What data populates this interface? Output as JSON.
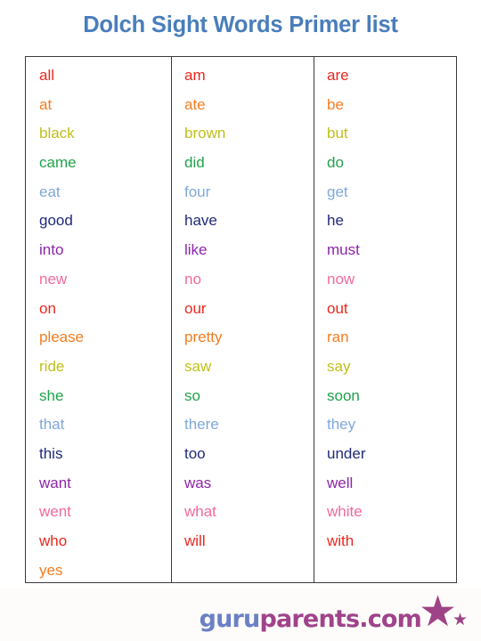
{
  "page": {
    "title": "Dolch Sight Words Primer list",
    "background_color": "#ffffff",
    "title_color": "#4a7ebb",
    "border_color": "#3b3b3b"
  },
  "palette": {
    "red": "#e8281e",
    "orange": "#f57c20",
    "olive": "#bfbf1a",
    "green": "#21a24a",
    "light_blue": "#7fa8dc",
    "navy": "#1f2a7a",
    "purple": "#8e24aa",
    "pink": "#f2699f"
  },
  "table": {
    "columns": [
      {
        "name": "column-1",
        "words": [
          {
            "text": "all",
            "color": "#e8281e"
          },
          {
            "text": "at",
            "color": "#f57c20"
          },
          {
            "text": "black",
            "color": "#bfbf1a"
          },
          {
            "text": "came",
            "color": "#21a24a"
          },
          {
            "text": "eat",
            "color": "#7fa8dc"
          },
          {
            "text": "good",
            "color": "#1f2a7a"
          },
          {
            "text": "into",
            "color": "#8e24aa"
          },
          {
            "text": "new",
            "color": "#f2699f"
          },
          {
            "text": "on",
            "color": "#e8281e"
          },
          {
            "text": "please",
            "color": "#f57c20"
          },
          {
            "text": "ride",
            "color": "#bfbf1a"
          },
          {
            "text": "she",
            "color": "#21a24a"
          },
          {
            "text": "that",
            "color": "#7fa8dc"
          },
          {
            "text": "this",
            "color": "#1f2a7a"
          },
          {
            "text": "want",
            "color": "#8e24aa"
          },
          {
            "text": "went",
            "color": "#f2699f"
          },
          {
            "text": "who",
            "color": "#e8281e"
          },
          {
            "text": "yes",
            "color": "#f57c20"
          }
        ]
      },
      {
        "name": "column-2",
        "words": [
          {
            "text": "am",
            "color": "#e8281e"
          },
          {
            "text": "ate",
            "color": "#f57c20"
          },
          {
            "text": "brown",
            "color": "#bfbf1a"
          },
          {
            "text": "did",
            "color": "#21a24a"
          },
          {
            "text": "four",
            "color": "#7fa8dc"
          },
          {
            "text": "have",
            "color": "#1f2a7a"
          },
          {
            "text": "like",
            "color": "#8e24aa"
          },
          {
            "text": "no",
            "color": "#f2699f"
          },
          {
            "text": "our",
            "color": "#e8281e"
          },
          {
            "text": "pretty",
            "color": "#f57c20"
          },
          {
            "text": "saw",
            "color": "#bfbf1a"
          },
          {
            "text": "so",
            "color": "#21a24a"
          },
          {
            "text": "there",
            "color": "#7fa8dc"
          },
          {
            "text": "too",
            "color": "#1f2a7a"
          },
          {
            "text": "was",
            "color": "#8e24aa"
          },
          {
            "text": "what",
            "color": "#f2699f"
          },
          {
            "text": "will",
            "color": "#e8281e"
          }
        ]
      },
      {
        "name": "column-3",
        "words": [
          {
            "text": "are",
            "color": "#e8281e"
          },
          {
            "text": "be",
            "color": "#f57c20"
          },
          {
            "text": "but",
            "color": "#bfbf1a"
          },
          {
            "text": "do",
            "color": "#21a24a"
          },
          {
            "text": "get",
            "color": "#7fa8dc"
          },
          {
            "text": "he",
            "color": "#1f2a7a"
          },
          {
            "text": "must",
            "color": "#8e24aa"
          },
          {
            "text": "now",
            "color": "#f2699f"
          },
          {
            "text": "out",
            "color": "#e8281e"
          },
          {
            "text": "ran",
            "color": "#f57c20"
          },
          {
            "text": "say",
            "color": "#bfbf1a"
          },
          {
            "text": "soon",
            "color": "#21a24a"
          },
          {
            "text": "they",
            "color": "#7fa8dc"
          },
          {
            "text": "under",
            "color": "#1f2a7a"
          },
          {
            "text": "well",
            "color": "#8e24aa"
          },
          {
            "text": "white",
            "color": "#f2699f"
          },
          {
            "text": "with",
            "color": "#e8281e"
          }
        ]
      }
    ]
  },
  "footer": {
    "logo_part_1": "guru",
    "logo_part_2": "parents.com",
    "logo_part_1_color": "#6b80c4",
    "logo_part_2_color": "#a0438b",
    "star_color": "#9e4388",
    "star_big": "★",
    "star_small": "★"
  }
}
